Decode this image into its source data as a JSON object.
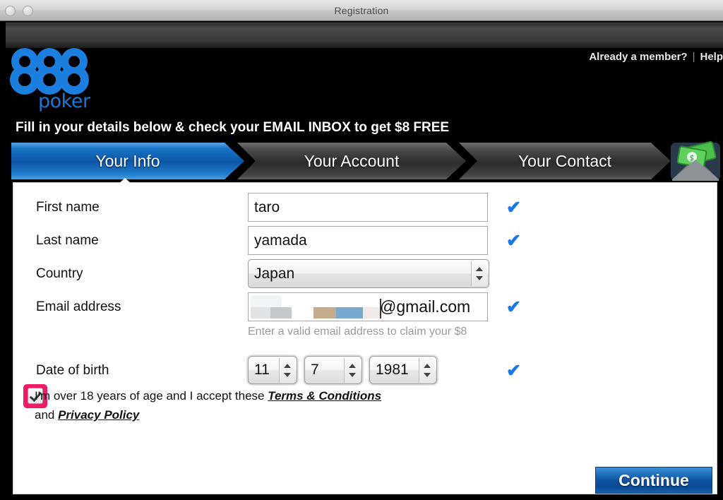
{
  "window": {
    "title": "Registration",
    "controls": [
      "close",
      "minimize"
    ]
  },
  "header": {
    "logo_word": "poker",
    "logo_digits": "888",
    "member_link": "Already a member?",
    "separator": "|",
    "help_link": "Help",
    "tagline": "Fill in your details below & check your EMAIL INBOX to get $8 FREE",
    "money_icon": "money-envelope-icon"
  },
  "steps": [
    {
      "label": "Your Info",
      "active": true
    },
    {
      "label": "Your Account",
      "active": false
    },
    {
      "label": "Your Contact",
      "active": false
    }
  ],
  "form": {
    "first_name": {
      "label": "First name",
      "value": "taro",
      "valid": true
    },
    "last_name": {
      "label": "Last name",
      "value": "yamada",
      "valid": true
    },
    "country": {
      "label": "Country",
      "value": "Japan"
    },
    "email": {
      "label": "Email address",
      "domain": "@gmail.com",
      "valid": true,
      "hint": "Enter a valid email address to claim your $8"
    },
    "dob": {
      "label": "Date of birth",
      "day": "11",
      "month": "7",
      "year": "1981",
      "valid": true
    },
    "checkmark_glyph": "✔",
    "accent_blue": "#1878e8"
  },
  "terms": {
    "checked": true,
    "highlight_color": "#ef1a68",
    "text_before": "I'm over 18 years of age and I accept these ",
    "terms_link": "Terms & Conditions",
    "text_middle": "and ",
    "privacy_link": "Privacy Policy"
  },
  "footer": {
    "continue_label": "Continue"
  }
}
